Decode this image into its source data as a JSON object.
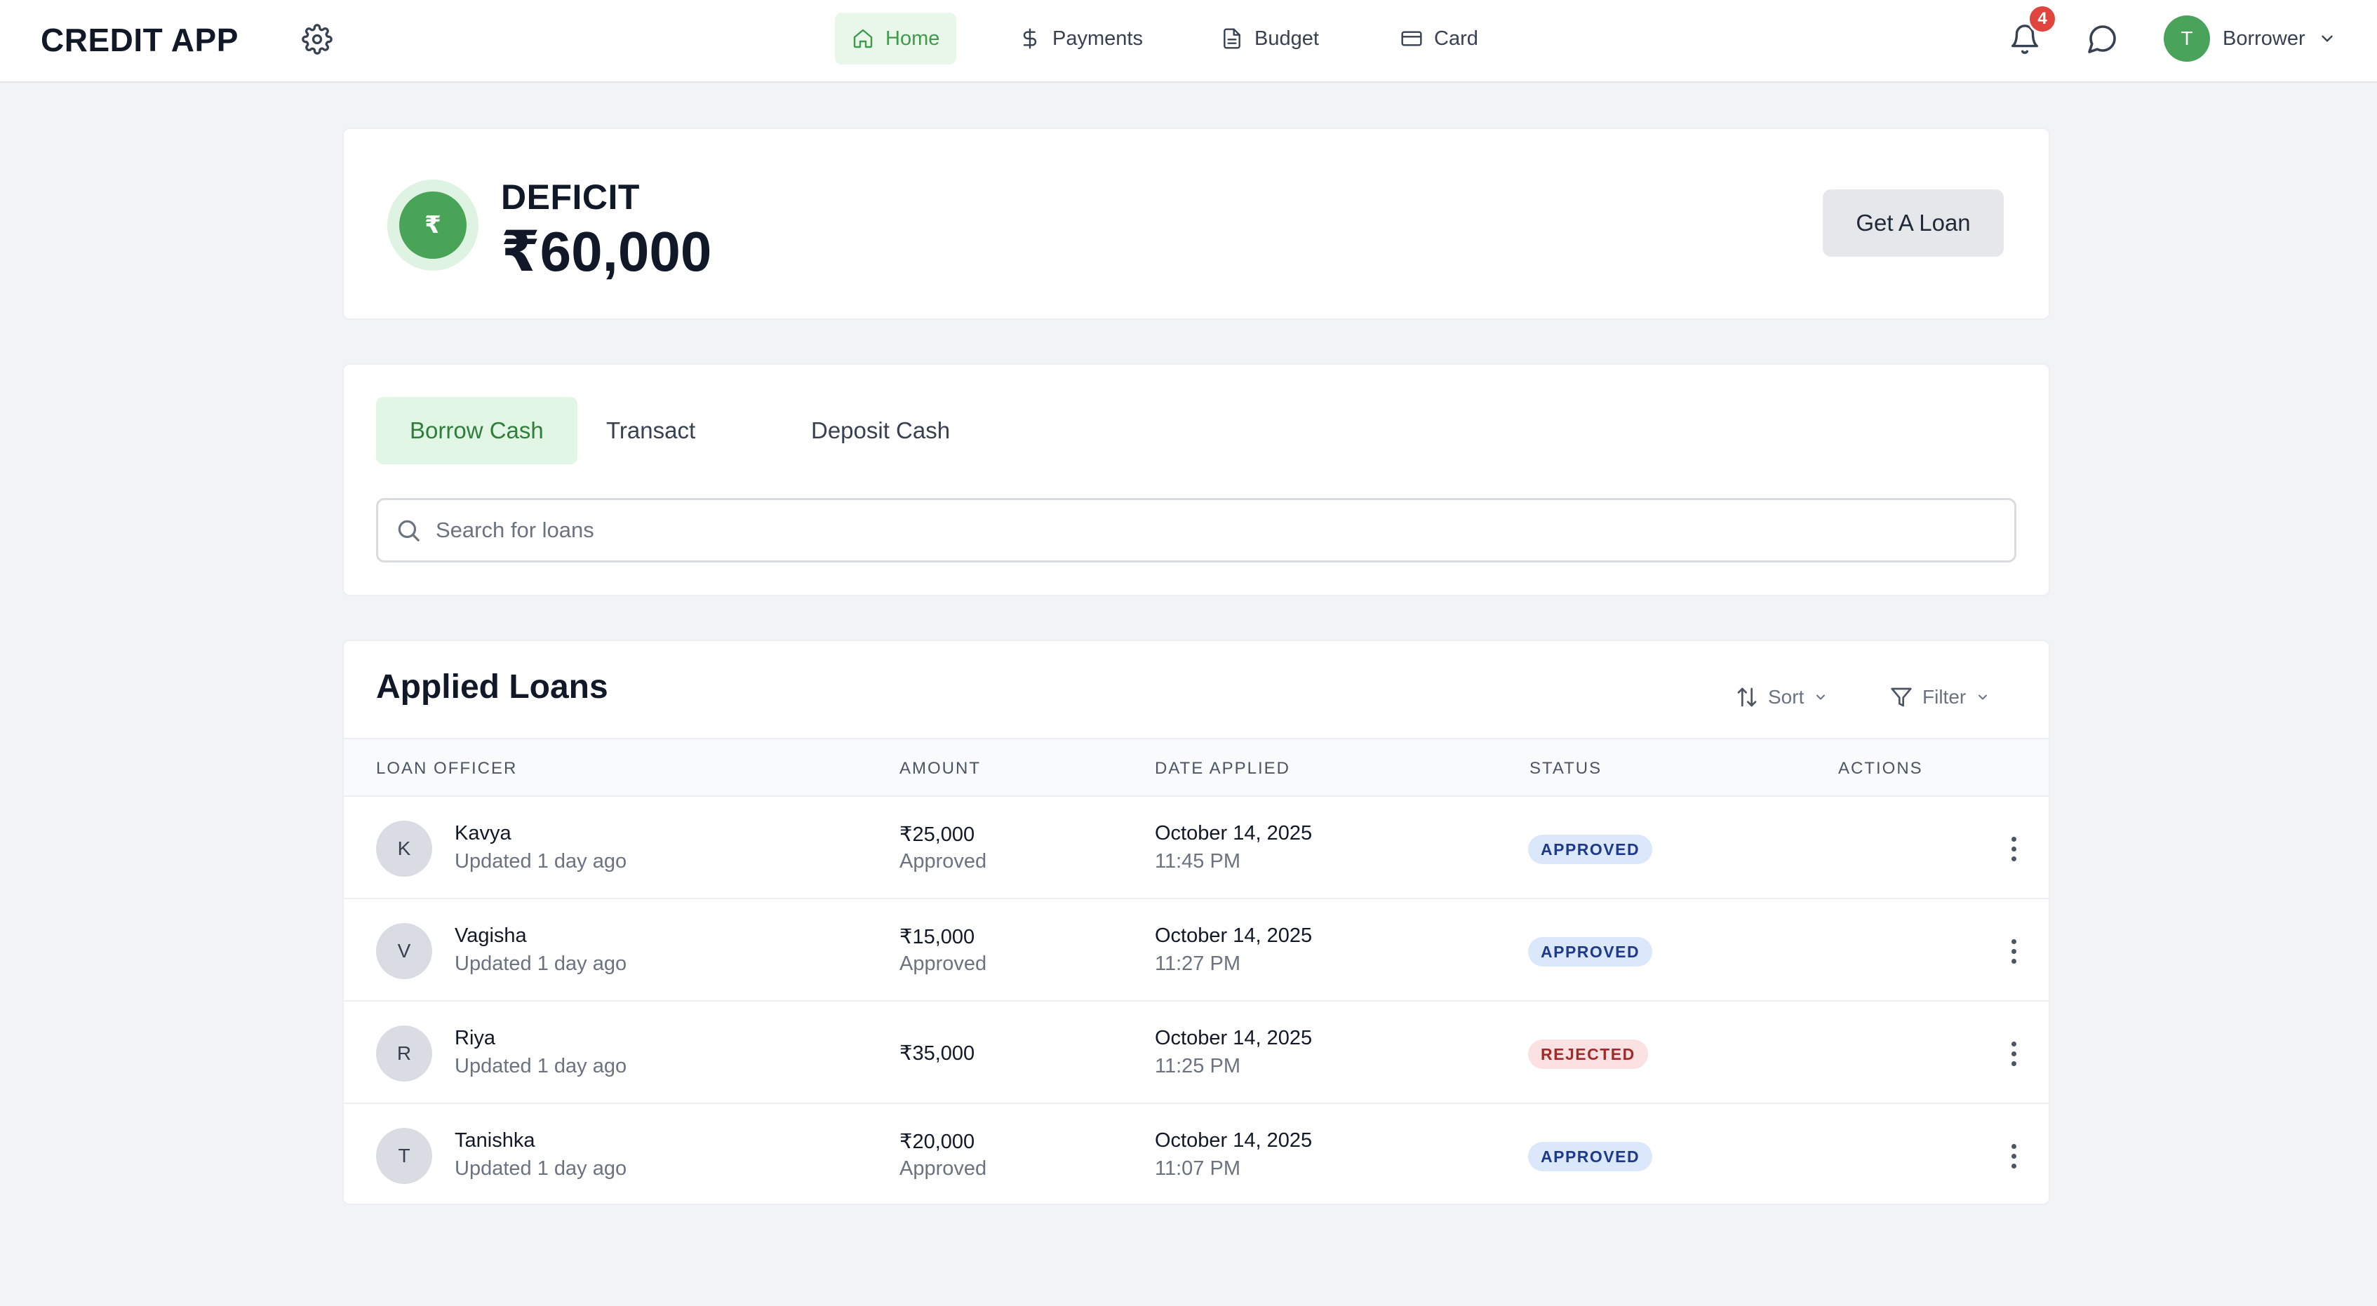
{
  "app": {
    "title": "CREDIT APP"
  },
  "nav": {
    "items": [
      {
        "label": "Home",
        "icon": "home-icon",
        "active": true
      },
      {
        "label": "Payments",
        "icon": "dollar-icon",
        "active": false
      },
      {
        "label": "Budget",
        "icon": "document-icon",
        "active": false
      },
      {
        "label": "Card",
        "icon": "credit-card-icon",
        "active": false
      }
    ]
  },
  "header": {
    "notification_count": "4",
    "user": {
      "initial": "T",
      "name": "Borrower"
    }
  },
  "balance": {
    "symbol": "₹",
    "label": "DEFICIT",
    "value": "₹60,000",
    "action_label": "Get A Loan"
  },
  "tabs": [
    {
      "label": "Borrow Cash",
      "active": true
    },
    {
      "label": "Transact",
      "active": false
    },
    {
      "label": "Deposit Cash",
      "active": false
    }
  ],
  "search": {
    "placeholder": "Search for loans"
  },
  "loans": {
    "title": "Applied Loans",
    "sort_label": "Sort",
    "filter_label": "Filter",
    "columns": [
      "LOAN OFFICER",
      "AMOUNT",
      "DATE APPLIED",
      "STATUS",
      "ACTIONS"
    ],
    "rows": [
      {
        "initial": "K",
        "officer": "Kavya",
        "updated": "Updated 1 day ago",
        "amount": "₹25,000",
        "amount_sub": "Approved",
        "date": "October 14, 2025",
        "time": "11:45 PM",
        "status": "APPROVED"
      },
      {
        "initial": "V",
        "officer": "Vagisha",
        "updated": "Updated 1 day ago",
        "amount": "₹15,000",
        "amount_sub": "Approved",
        "date": "October 14, 2025",
        "time": "11:27 PM",
        "status": "APPROVED"
      },
      {
        "initial": "R",
        "officer": "Riya",
        "updated": "Updated 1 day ago",
        "amount": "₹35,000",
        "amount_sub": "",
        "date": "October 14, 2025",
        "time": "11:25 PM",
        "status": "REJECTED"
      },
      {
        "initial": "T",
        "officer": "Tanishka",
        "updated": "Updated 1 day ago",
        "amount": "₹20,000",
        "amount_sub": "Approved",
        "date": "October 14, 2025",
        "time": "11:07 PM",
        "status": "APPROVED"
      }
    ]
  },
  "colors": {
    "accent": "#4aa35a",
    "accent_light": "#e8f7ea",
    "approved_bg": "#dbe7fb",
    "rejected_bg": "#fbe1e1",
    "badge": "#e0443c"
  }
}
